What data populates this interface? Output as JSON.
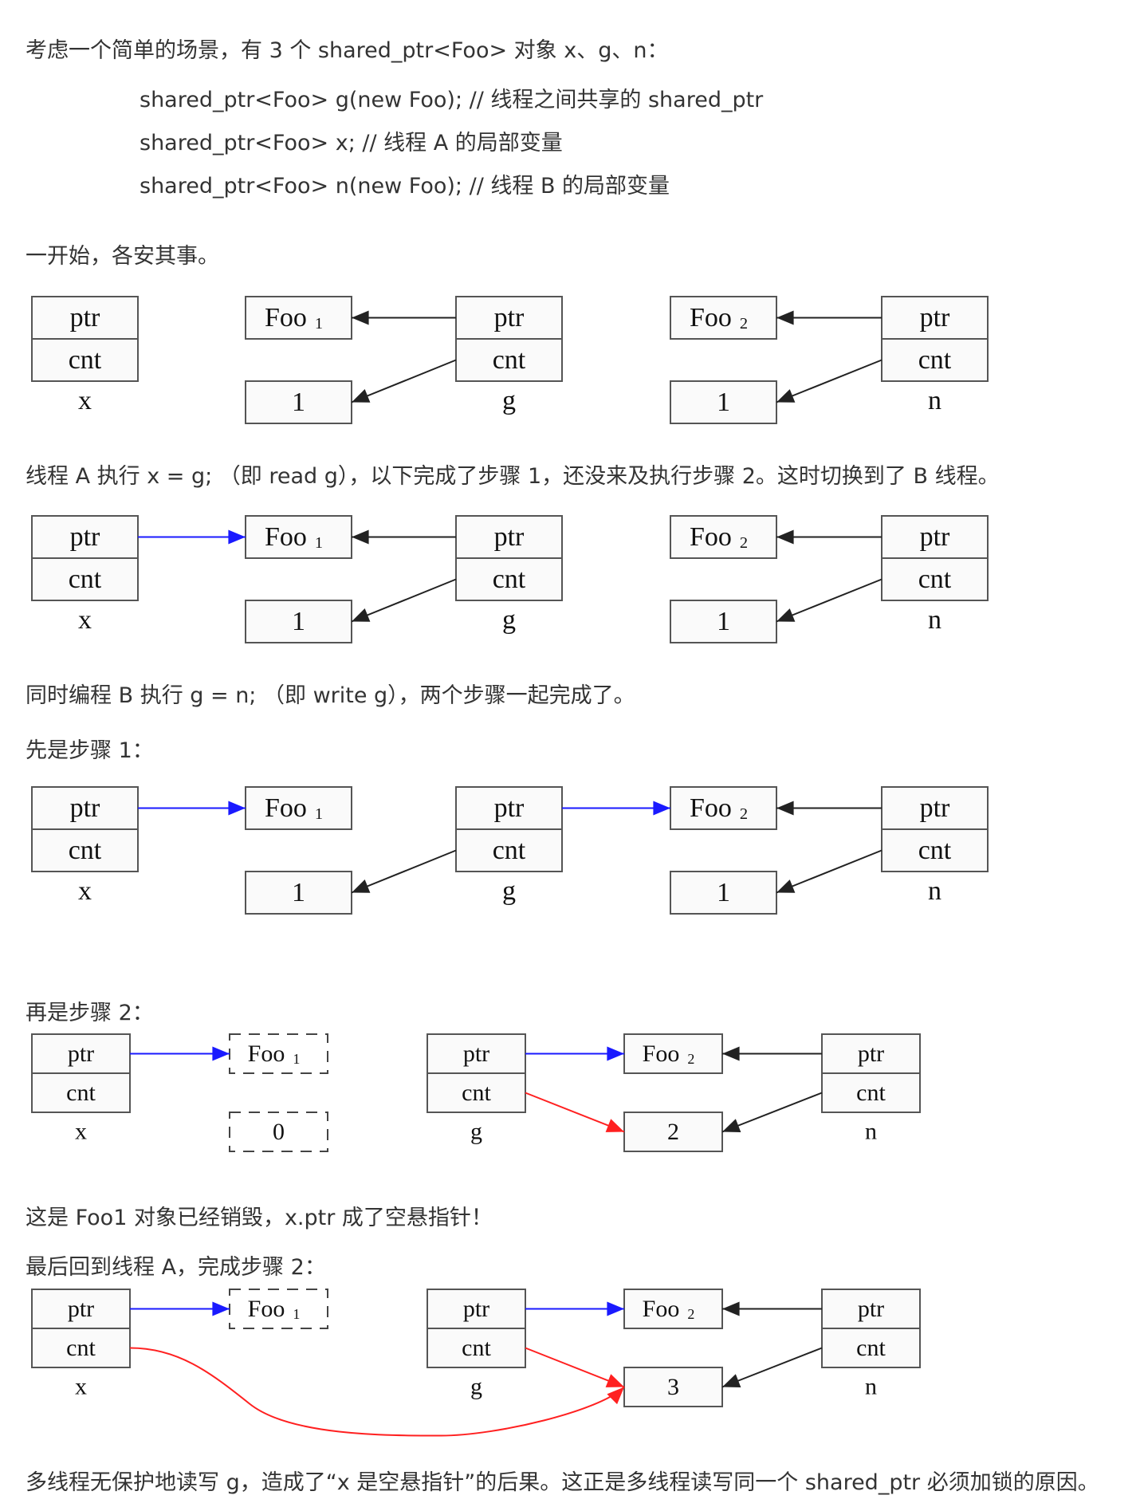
{
  "texts": {
    "intro": "考虑一个简单的场景，有 3 个 shared_ptr<Foo> 对象 x、g、n：",
    "code1": "shared_ptr<Foo> g(new Foo); // 线程之间共享的 shared_ptr",
    "code2": "shared_ptr<Foo> x; // 线程 A 的局部变量",
    "code3": "shared_ptr<Foo> n(new Foo); // 线程 B 的局部变量",
    "t1": "一开始，各安其事。",
    "t2": "线程 A 执行 x = g; （即 read g），以下完成了步骤 1，还没来及执行步骤 2。这时切换到了 B 线程。",
    "t3": "同时编程 B 执行 g = n; （即 write g），两个步骤一起完成了。",
    "t4": "先是步骤 1：",
    "t5": "再是步骤 2：",
    "t6": "这是 Foo1 对象已经销毁，x.ptr 成了空悬指针！",
    "t7": "最后回到线程 A，完成步骤 2：",
    "t8": "多线程无保护地读写 g，造成了“x 是空悬指针”的后果。这正是多线程读写同一个 shared_ptr 必须加锁的原因。"
  },
  "labels": {
    "ptr": "ptr",
    "cnt": "cnt",
    "foo": "Foo",
    "sub1": "1",
    "sub2": "2",
    "x": "x",
    "g": "g",
    "n": "n"
  },
  "colors": {
    "text": "#333333",
    "black_edge": "#222222",
    "blue_edge": "#1a1aff",
    "red_edge": "#ff2020"
  },
  "diagrams": [
    {
      "name": "initial-state",
      "font": 34,
      "nodes": [
        {
          "id": "x",
          "type": "sp",
          "ptr": "ptr",
          "cnt": "cnt",
          "label": "x"
        },
        {
          "id": "foo1",
          "type": "foo",
          "text": "Foo",
          "sub": "1"
        },
        {
          "id": "c1",
          "type": "cnt",
          "text": "1"
        },
        {
          "id": "g",
          "type": "sp",
          "ptr": "ptr",
          "cnt": "cnt",
          "label": "g"
        },
        {
          "id": "foo2",
          "type": "foo",
          "text": "Foo",
          "sub": "2"
        },
        {
          "id": "c2",
          "type": "cnt",
          "text": "1"
        },
        {
          "id": "n",
          "type": "sp",
          "ptr": "ptr",
          "cnt": "cnt",
          "label": "n"
        }
      ],
      "edges": [
        {
          "from": "g.ptr",
          "to": "foo1",
          "color": "black"
        },
        {
          "from": "g.cnt",
          "to": "c1",
          "color": "black"
        },
        {
          "from": "n.ptr",
          "to": "foo2",
          "color": "black"
        },
        {
          "from": "n.cnt",
          "to": "c2",
          "color": "black"
        }
      ]
    },
    {
      "name": "thread-a-step-1",
      "font": 34,
      "nodes": [
        {
          "id": "x",
          "type": "sp",
          "ptr": "ptr",
          "cnt": "cnt",
          "label": "x"
        },
        {
          "id": "foo1",
          "type": "foo",
          "text": "Foo",
          "sub": "1"
        },
        {
          "id": "c1",
          "type": "cnt",
          "text": "1"
        },
        {
          "id": "g",
          "type": "sp",
          "ptr": "ptr",
          "cnt": "cnt",
          "label": "g"
        },
        {
          "id": "foo2",
          "type": "foo",
          "text": "Foo",
          "sub": "2"
        },
        {
          "id": "c2",
          "type": "cnt",
          "text": "1"
        },
        {
          "id": "n",
          "type": "sp",
          "ptr": "ptr",
          "cnt": "cnt",
          "label": "n"
        }
      ],
      "edges": [
        {
          "from": "x.ptr",
          "to": "foo1",
          "color": "blue"
        },
        {
          "from": "g.ptr",
          "to": "foo1",
          "color": "black"
        },
        {
          "from": "g.cnt",
          "to": "c1",
          "color": "black"
        },
        {
          "from": "n.ptr",
          "to": "foo2",
          "color": "black"
        },
        {
          "from": "n.cnt",
          "to": "c2",
          "color": "black"
        }
      ]
    },
    {
      "name": "thread-b-step-1",
      "font": 34,
      "nodes": [
        {
          "id": "x",
          "type": "sp",
          "ptr": "ptr",
          "cnt": "cnt",
          "label": "x"
        },
        {
          "id": "foo1",
          "type": "foo",
          "text": "Foo",
          "sub": "1"
        },
        {
          "id": "c1",
          "type": "cnt",
          "text": "1"
        },
        {
          "id": "g",
          "type": "sp",
          "ptr": "ptr",
          "cnt": "cnt",
          "label": "g"
        },
        {
          "id": "foo2",
          "type": "foo",
          "text": "Foo",
          "sub": "2"
        },
        {
          "id": "c2",
          "type": "cnt",
          "text": "1"
        },
        {
          "id": "n",
          "type": "sp",
          "ptr": "ptr",
          "cnt": "cnt",
          "label": "n"
        }
      ],
      "edges": [
        {
          "from": "x.ptr",
          "to": "foo1",
          "color": "blue"
        },
        {
          "from": "g.ptr",
          "to": "foo2",
          "color": "blue"
        },
        {
          "from": "g.cnt",
          "to": "c1",
          "color": "black"
        },
        {
          "from": "n.ptr",
          "to": "foo2",
          "color": "black"
        },
        {
          "from": "n.cnt",
          "to": "c2",
          "color": "black"
        }
      ]
    },
    {
      "name": "thread-b-step-2",
      "font": 30,
      "nodes": [
        {
          "id": "x",
          "type": "sp",
          "ptr": "ptr",
          "cnt": "cnt",
          "label": "x"
        },
        {
          "id": "foo1",
          "type": "foo",
          "text": "Foo",
          "sub": "1",
          "dashed": true
        },
        {
          "id": "c1",
          "type": "cnt",
          "text": "0",
          "dashed": true
        },
        {
          "id": "g",
          "type": "sp",
          "ptr": "ptr",
          "cnt": "cnt",
          "label": "g"
        },
        {
          "id": "foo2",
          "type": "foo",
          "text": "Foo",
          "sub": "2"
        },
        {
          "id": "c2",
          "type": "cnt",
          "text": "2"
        },
        {
          "id": "n",
          "type": "sp",
          "ptr": "ptr",
          "cnt": "cnt",
          "label": "n"
        }
      ],
      "edges": [
        {
          "from": "x.ptr",
          "to": "foo1",
          "color": "blue"
        },
        {
          "from": "g.ptr",
          "to": "foo2",
          "color": "blue"
        },
        {
          "from": "g.cnt",
          "to": "c2",
          "color": "red"
        },
        {
          "from": "n.ptr",
          "to": "foo2",
          "color": "black"
        },
        {
          "from": "n.cnt",
          "to": "c2",
          "color": "black"
        }
      ]
    },
    {
      "name": "thread-a-step-2",
      "font": 30,
      "nodes": [
        {
          "id": "x",
          "type": "sp",
          "ptr": "ptr",
          "cnt": "cnt",
          "label": "x"
        },
        {
          "id": "foo1",
          "type": "foo",
          "text": "Foo",
          "sub": "1",
          "dashed": true
        },
        {
          "id": "g",
          "type": "sp",
          "ptr": "ptr",
          "cnt": "cnt",
          "label": "g"
        },
        {
          "id": "foo2",
          "type": "foo",
          "text": "Foo",
          "sub": "2"
        },
        {
          "id": "c2",
          "type": "cnt",
          "text": "3"
        },
        {
          "id": "n",
          "type": "sp",
          "ptr": "ptr",
          "cnt": "cnt",
          "label": "n"
        }
      ],
      "edges": [
        {
          "from": "x.ptr",
          "to": "foo1",
          "color": "blue"
        },
        {
          "from": "x.cnt",
          "to": "c2",
          "color": "red",
          "curve": true
        },
        {
          "from": "g.ptr",
          "to": "foo2",
          "color": "blue"
        },
        {
          "from": "g.cnt",
          "to": "c2",
          "color": "red"
        },
        {
          "from": "n.ptr",
          "to": "foo2",
          "color": "black"
        },
        {
          "from": "n.cnt",
          "to": "c2",
          "color": "black"
        }
      ]
    }
  ]
}
